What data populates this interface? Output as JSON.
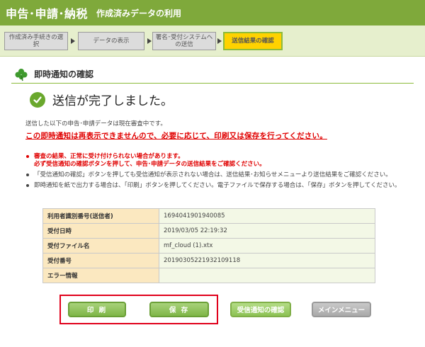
{
  "header": {
    "title": "申告･申請･納税",
    "subtitle": "作成済みデータの利用"
  },
  "steps": [
    {
      "label": "作成済み手続きの選択",
      "state": "done"
    },
    {
      "label": "データの表示",
      "state": "done"
    },
    {
      "label": "署名･受付システムへの送信",
      "state": "done"
    },
    {
      "label": "送信結果の確認",
      "state": "current"
    }
  ],
  "section": {
    "title": "即時通知の確認",
    "icon": "clover-icon"
  },
  "status": {
    "icon": "check-icon",
    "message": "送信が完了しました。"
  },
  "notices": {
    "under_review": "送信した以下の申告･申請データは現在審査中です。",
    "warning": "この即時通知は再表示できませんので、必要に応じて、印刷又は保存を行ってください。"
  },
  "bullets": [
    {
      "text": "審査の結果、正常に受け付けられない場合があります。",
      "text2": "必ず受信通知の確認ボタンを押して、申告･申請データの送信結果をご確認ください。",
      "red": true
    },
    {
      "text": "「受信通知の確認」ボタンを押しても受信通知が表示されない場合は、送信結果･お知らせメニューより送信結果をご確認ください。",
      "red": false
    },
    {
      "text": "即時通知を紙で出力する場合は、「印刷」ボタンを押してください。電子ファイルで保存する場合は、「保存」ボタンを押してください。",
      "red": false
    }
  ],
  "table": [
    {
      "label": "利用者識別番号(送信者)",
      "value": "1694041901940085"
    },
    {
      "label": "受付日時",
      "value": "2019/03/05 22:19:32"
    },
    {
      "label": "受付ファイル名",
      "value": "mf_cloud (1).xtx"
    },
    {
      "label": "受付番号",
      "value": "20190305221932109118"
    },
    {
      "label": "エラー情報",
      "value": ""
    }
  ],
  "buttons": {
    "print": "印 刷",
    "save": "保 存",
    "check_receipt": "受信通知の確認",
    "main_menu": "メインメニュー"
  },
  "colors": {
    "header_green": "#7fa93b",
    "warning_red": "#e00000",
    "active_step": "#ffd200"
  }
}
